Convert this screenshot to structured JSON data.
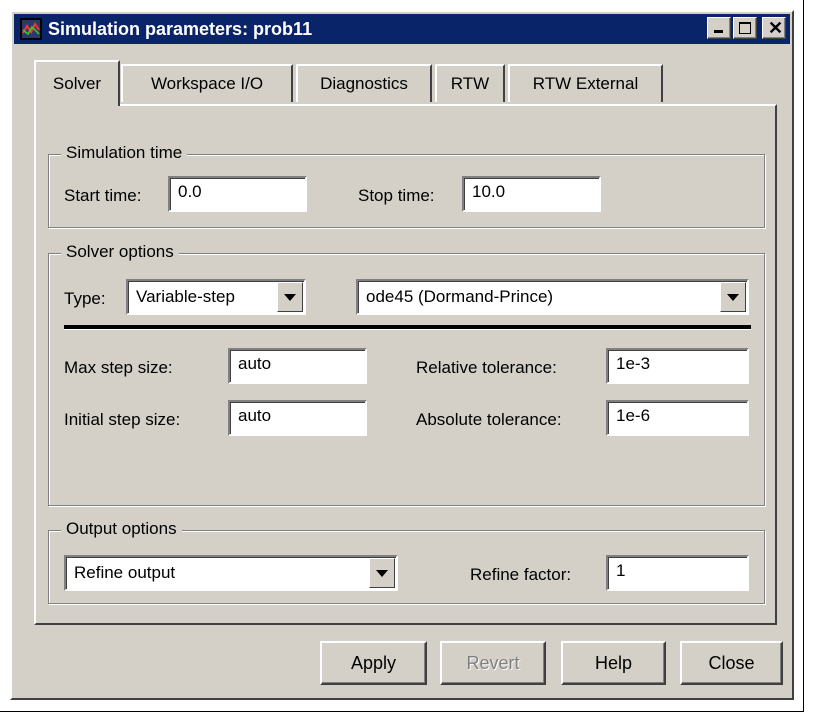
{
  "window": {
    "title": "Simulation parameters: prob11"
  },
  "tabs": [
    {
      "label": "Solver",
      "active": true
    },
    {
      "label": "Workspace I/O",
      "active": false
    },
    {
      "label": "Diagnostics",
      "active": false
    },
    {
      "label": "RTW",
      "active": false
    },
    {
      "label": "RTW External",
      "active": false
    }
  ],
  "simulation_time": {
    "legend": "Simulation time",
    "start_label": "Start time:",
    "start_value": "0.0",
    "stop_label": "Stop time:",
    "stop_value": "10.0"
  },
  "solver_options": {
    "legend": "Solver options",
    "type_label": "Type:",
    "type_value": "Variable-step",
    "solver_value": "ode45 (Dormand-Prince)",
    "max_step_label": "Max step size:",
    "max_step_value": "auto",
    "initial_step_label": "Initial step size:",
    "initial_step_value": "auto",
    "rel_tol_label": "Relative tolerance:",
    "rel_tol_value": "1e-3",
    "abs_tol_label": "Absolute tolerance:",
    "abs_tol_value": "1e-6"
  },
  "output_options": {
    "legend": "Output options",
    "output_value": "Refine output",
    "refine_label": "Refine factor:",
    "refine_value": "1"
  },
  "buttons": {
    "apply": "Apply",
    "revert": "Revert",
    "help": "Help",
    "close": "Close"
  },
  "colors": {
    "titlebar": "#0a246a",
    "face": "#d4d0c8"
  }
}
